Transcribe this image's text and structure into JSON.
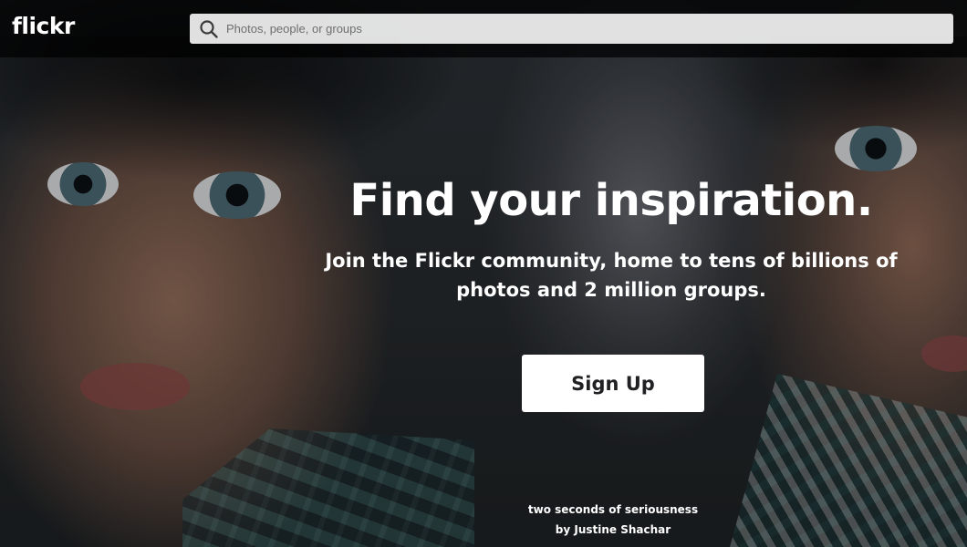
{
  "header": {
    "logo_text": "flickr",
    "search": {
      "placeholder": "Photos, people, or groups",
      "value": "",
      "icon": "search-icon"
    }
  },
  "hero": {
    "title": "Find your inspiration.",
    "subtitle": "Join the Flickr community, home to tens of billions of photos and 2 million groups.",
    "signup_label": "Sign Up"
  },
  "photo_credit": {
    "title": "two seconds of seriousness",
    "author_line": "by Justine Shachar"
  },
  "colors": {
    "topbar_bg": "#000000",
    "text": "#ffffff",
    "button_bg": "#ffffff",
    "button_text": "#212124"
  }
}
